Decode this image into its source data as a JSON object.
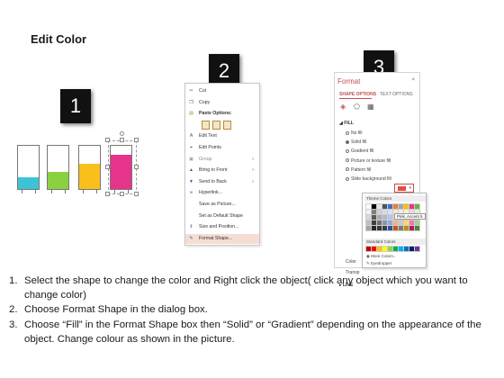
{
  "title": "Edit Color",
  "badges": [
    "1",
    "2",
    "3"
  ],
  "bars": [
    {
      "fill_color": "#3cc4d6",
      "level": 0.28
    },
    {
      "fill_color": "#8bd13f",
      "level": 0.4
    },
    {
      "fill_color": "#f9bf1d",
      "level": 0.58
    },
    {
      "fill_color": "#e6338c",
      "level": 0.8
    }
  ],
  "context_menu": {
    "items": [
      {
        "icon": "scissors-icon",
        "label": "Cut",
        "arrow": ""
      },
      {
        "icon": "copy-icon",
        "label": "Copy",
        "arrow": ""
      },
      {
        "icon": "paste-icon",
        "label": "Paste Options:",
        "arrow": "",
        "bold": true
      },
      {
        "icon": "",
        "label": "",
        "arrow": ""
      },
      {
        "icon": "edit-text-icon",
        "label": "Edit Text",
        "arrow": ""
      },
      {
        "icon": "edit-points-icon",
        "label": "Edit Points",
        "arrow": ""
      },
      {
        "icon": "group-icon",
        "label": "Group",
        "arrow": "›",
        "dim": true
      },
      {
        "icon": "bring-to-front-icon",
        "label": "Bring to Front",
        "arrow": "›"
      },
      {
        "icon": "send-to-back-icon",
        "label": "Send to Back",
        "arrow": "›"
      },
      {
        "icon": "hyperlink-icon",
        "label": "Hyperlink...",
        "arrow": ""
      },
      {
        "icon": "",
        "label": "Save as Picture...",
        "arrow": ""
      },
      {
        "icon": "",
        "label": "Set as Default Shape",
        "arrow": ""
      },
      {
        "icon": "size-position-icon",
        "label": "Size and Position...",
        "arrow": ""
      },
      {
        "icon": "format-shape-icon",
        "label": "Format Shape...",
        "arrow": "",
        "highlight": true
      }
    ]
  },
  "format_pane": {
    "title": "Format",
    "close": "×",
    "tabs": [
      "SHAPE OPTIONS",
      "TEXT OPTIONS"
    ],
    "fill_section": "FILL",
    "fill_options": [
      "No fill",
      "Solid fill",
      "Gradient fill",
      "Picture or texture fill",
      "Pattern fill",
      "Slide background fill"
    ],
    "selected_fill": "Solid fill",
    "color_label": "Color",
    "transparency_label": "Transp",
    "line_section": "LINE",
    "color_value": "#e74c3c"
  },
  "palette": {
    "theme_label": "Theme Colors",
    "standard_label": "Standard Colors",
    "tooltip": "Pink, Accent 5",
    "more_colors": "More Colors...",
    "eyedropper": "Eyedropper",
    "theme_colors": [
      "#ffffff",
      "#000000",
      "#e7e6e6",
      "#44546a",
      "#4472c4",
      "#ed7d31",
      "#a5a5a5",
      "#ffc000",
      "#e6338c",
      "#70ad47",
      "#f2f2f2",
      "#7f7f7f",
      "#d0cece",
      "#d6dce4",
      "#d9e2f3",
      "#fbe5d5",
      "#ededed",
      "#fff2cc",
      "#fbd1e6",
      "#e2efd9",
      "#d8d8d8",
      "#595959",
      "#aeabab",
      "#adb9ca",
      "#b4c6e7",
      "#f7cbac",
      "#dbdbdb",
      "#fee599",
      "#f6a3cc",
      "#c5e0b3",
      "#bfbfbf",
      "#3f3f3f",
      "#757070",
      "#8496b0",
      "#8eaadb",
      "#f4b183",
      "#c9c9c9",
      "#ffd965",
      "#f175b3",
      "#a8d08d",
      "#a5a5a5",
      "#262626",
      "#3a3838",
      "#323f4f",
      "#2f5496",
      "#c55a11",
      "#7b7b7b",
      "#bf9000",
      "#b01b66",
      "#538135"
    ],
    "standard_colors": [
      "#c00000",
      "#ff0000",
      "#ffc000",
      "#ffff00",
      "#92d050",
      "#00b050",
      "#00b0f0",
      "#0070c0",
      "#002060",
      "#7030a0"
    ]
  },
  "steps": [
    {
      "num": "1.",
      "text": "Select the shape to change the color and Right click the object( click any object which you want to change color)"
    },
    {
      "num": "2.",
      "text": "Choose Format Shape in the dialog box."
    },
    {
      "num": "3.",
      "text": "Choose “Fill” in the Format Shape box then “Solid” or “Gradient” depending on the appearance of the object. Change colour as shown in the picture."
    }
  ]
}
